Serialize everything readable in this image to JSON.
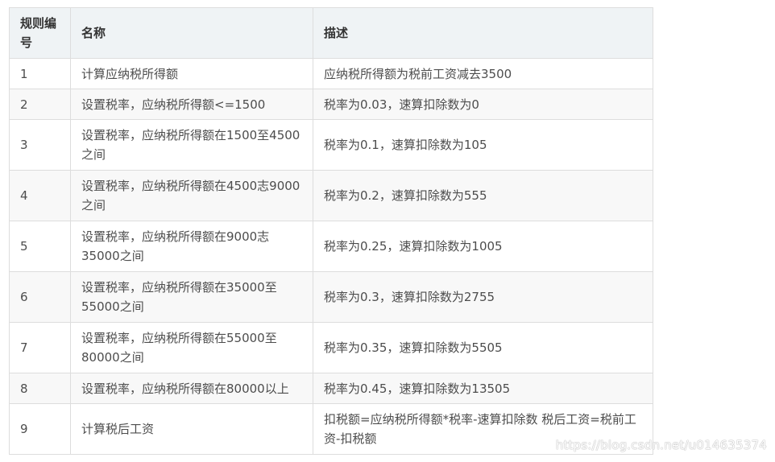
{
  "table": {
    "headers": {
      "id": "规则编号",
      "name": "名称",
      "description": "描述"
    },
    "rows": [
      {
        "id": "1",
        "name": "计算应纳税所得额",
        "description": "应纳税所得额为税前工资减去3500"
      },
      {
        "id": "2",
        "name": "设置税率，应纳税所得额<=1500",
        "description": "税率为0.03，速算扣除数为0"
      },
      {
        "id": "3",
        "name": "设置税率，应纳税所得额在1500至4500之间",
        "description": "税率为0.1，速算扣除数为105"
      },
      {
        "id": "4",
        "name": "设置税率，应纳税所得额在4500志9000之间",
        "description": "税率为0.2，速算扣除数为555"
      },
      {
        "id": "5",
        "name": "设置税率，应纳税所得额在9000志35000之间",
        "description": "税率为0.25，速算扣除数为1005"
      },
      {
        "id": "6",
        "name": "设置税率，应纳税所得额在35000至55000之间",
        "description": "税率为0.3，速算扣除数为2755"
      },
      {
        "id": "7",
        "name": "设置税率，应纳税所得额在55000至80000之间",
        "description": "税率为0.35，速算扣除数为5505"
      },
      {
        "id": "8",
        "name": "设置税率，应纳税所得额在80000以上",
        "description": "税率为0.45，速算扣除数为13505"
      },
      {
        "id": "9",
        "name": "计算税后工资",
        "description": "扣税额=应纳税所得额*税率-速算扣除数 税后工资=税前工资-扣税额"
      }
    ]
  },
  "watermark": "https://blog.csdn.net/u014635374"
}
